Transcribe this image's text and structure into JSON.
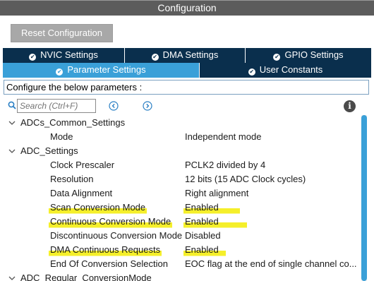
{
  "panel": {
    "title": "Configuration"
  },
  "toolbar": {
    "reset_label": "Reset Configuration"
  },
  "tabs_row1": [
    {
      "label": "NVIC Settings"
    },
    {
      "label": "DMA Settings"
    },
    {
      "label": "GPIO Settings"
    }
  ],
  "tabs_row2": [
    {
      "label": "Parameter Settings",
      "active": true
    },
    {
      "label": "User Constants"
    }
  ],
  "config_prompt": "Configure the below parameters :",
  "search": {
    "placeholder": "Search (Ctrl+F)"
  },
  "tree": {
    "groups": [
      {
        "label": "ADCs_Common_Settings",
        "params": [
          {
            "name": "Mode",
            "value": "Independent mode"
          }
        ]
      },
      {
        "label": "ADC_Settings",
        "params": [
          {
            "name": "Clock Prescaler",
            "value": "PCLK2 divided by 4"
          },
          {
            "name": "Resolution",
            "value": "12 bits (15 ADC Clock cycles)"
          },
          {
            "name": "Data Alignment",
            "value": "Right alignment"
          },
          {
            "name": "Scan Conversion Mode",
            "value": "Enabled"
          },
          {
            "name": "Continuous Conversion Mode",
            "value": "Enabled"
          },
          {
            "name": "Discontinuous Conversion Mode",
            "value": "Disabled"
          },
          {
            "name": "DMA Continuous Requests",
            "value": "Enabled"
          },
          {
            "name": "End Of Conversion Selection",
            "value": "EOC flag at the end of single channel co..."
          }
        ]
      },
      {
        "label": "ADC_Regular_ConversionMode",
        "params": []
      }
    ]
  },
  "colors": {
    "tab_dark": "#0a2f4d",
    "tab_active": "#3aa0d8",
    "highlight": "#f5ef2a",
    "title_bar": "#5c5c5c"
  }
}
